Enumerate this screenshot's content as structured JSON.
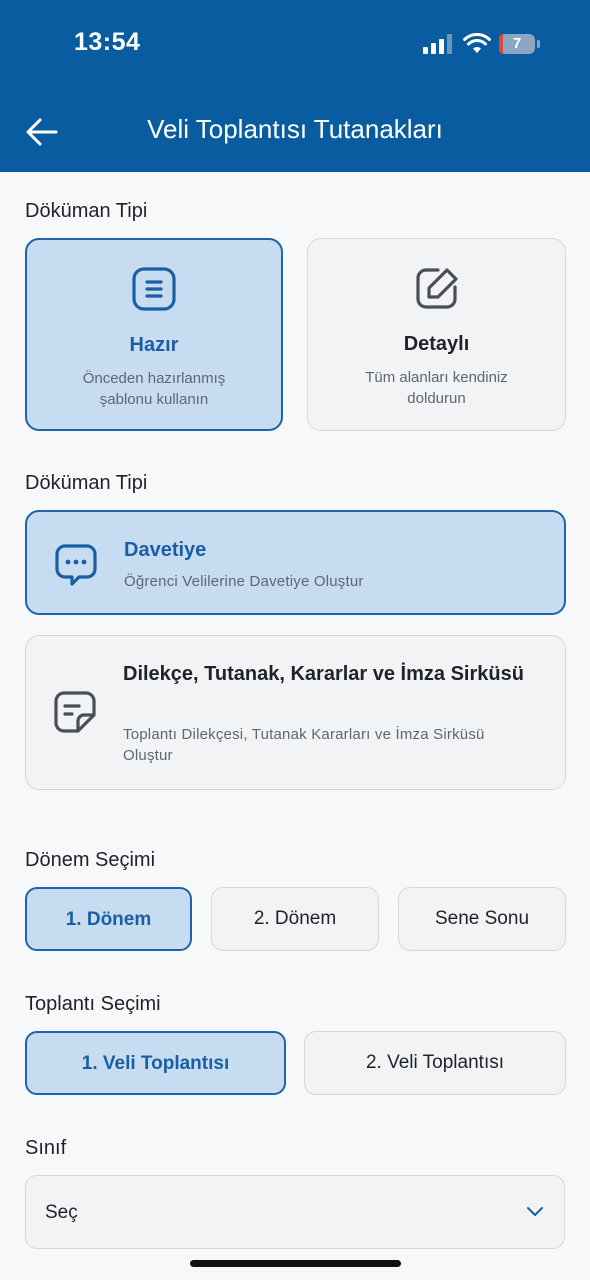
{
  "status_bar": {
    "time": "13:54",
    "battery": "7"
  },
  "header": {
    "title": "Veli Toplantısı Tutanakları"
  },
  "section1": {
    "label": "Döküman Tipi",
    "cards": [
      {
        "title": "Hazır",
        "desc": "Önceden hazırlanmış şablonu kullanın",
        "icon": "template-icon",
        "selected": true
      },
      {
        "title": "Detaylı",
        "desc": "Tüm alanları kendiniz doldurun",
        "icon": "edit-icon",
        "selected": false
      }
    ]
  },
  "section2": {
    "label": "Döküman Tipi",
    "cards": [
      {
        "title": "Davetiye",
        "desc": "Öğrenci Velilerine Davetiye Oluştur",
        "icon": "chat-icon",
        "selected": true
      },
      {
        "title": "Dilekçe, Tutanak, Kararlar ve İmza Sirküsü",
        "desc": "Toplantı Dilekçesi, Tutanak Kararları ve İmza Sirküsü Oluştur",
        "icon": "note-icon",
        "selected": false
      }
    ]
  },
  "period": {
    "label": "Dönem Seçimi",
    "options": [
      "1. Dönem",
      "2. Dönem",
      "Sene Sonu"
    ],
    "selected": "1. Dönem"
  },
  "meeting": {
    "label": "Toplantı Seçimi",
    "options": [
      "1. Veli Toplantısı",
      "2. Veli Toplantısı"
    ],
    "selected": "1. Veli Toplantısı"
  },
  "class_select": {
    "label": "Sınıf",
    "value": "Seç"
  },
  "colors": {
    "primary": "#0a5ca0",
    "accent": "#1a5fa3",
    "selected_bg": "#c8dcf1"
  }
}
